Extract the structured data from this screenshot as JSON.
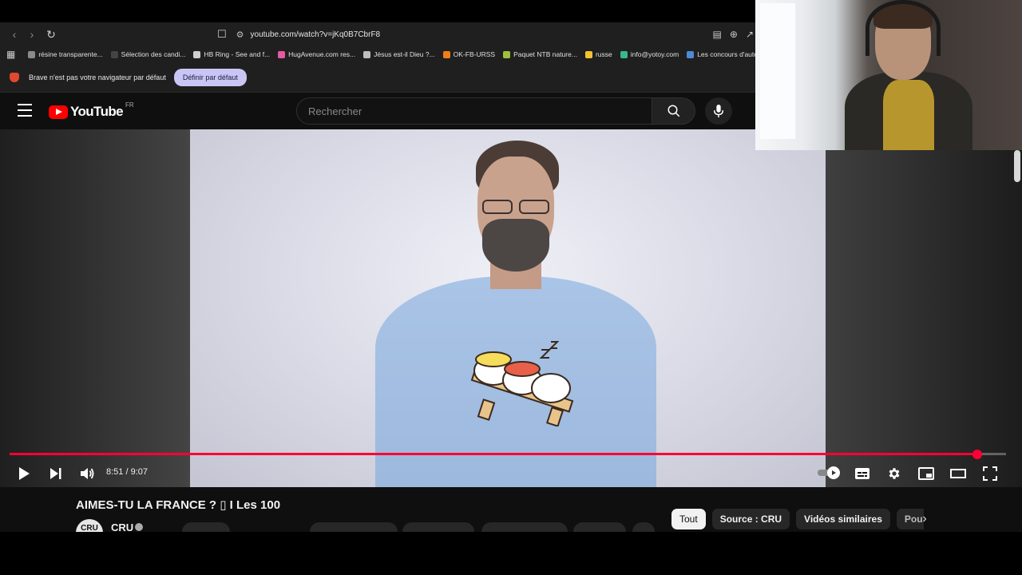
{
  "browser": {
    "url": "youtube.com/watch?v=jKq0B7CbrF8",
    "bookmarks": [
      {
        "label": "résine transparente...",
        "color": "#8a8a8a"
      },
      {
        "label": "Sélection des candi...",
        "color": "#444444"
      },
      {
        "label": "HB Ring - See and f...",
        "color": "#cfcfcf"
      },
      {
        "label": "HugAvenue.com res...",
        "color": "#e55aa0"
      },
      {
        "label": "Jésus est-il Dieu ?...",
        "color": "#bdbdbd"
      },
      {
        "label": "OK-FB-URSS",
        "color": "#f07d1a"
      },
      {
        "label": "Paquet NTB nature...",
        "color": "#9bc23c"
      },
      {
        "label": "russe",
        "color": "#f2c230"
      },
      {
        "label": "info@yotoy.com",
        "color": "#3bb58a"
      },
      {
        "label": "Les concours d'aute...",
        "color": "#4d8ad6"
      }
    ],
    "infobar": {
      "message": "Brave n'est pas votre navigateur par défaut",
      "button": "Définir par défaut"
    }
  },
  "youtube": {
    "logo_text": "YouTube",
    "country_code": "FR",
    "search_placeholder": "Rechercher"
  },
  "player": {
    "current_time": "8:51",
    "duration": "9:07",
    "time_display": "8:51 / 9:07",
    "progress": 0.971
  },
  "video": {
    "title": "AIMES-TU LA FRANCE ? ▯ I Les 100",
    "channel": "CRU",
    "avatar_text": "CRU"
  },
  "chips": [
    {
      "label": "Tout",
      "active": true
    },
    {
      "label": "Source : CRU",
      "active": false
    },
    {
      "label": "Vidéos similaires",
      "active": false
    },
    {
      "label": "Pou",
      "active": false
    }
  ],
  "colors": {
    "accent": "#ff0033",
    "youtube_red": "#ff0000",
    "background": "#0f0f0f"
  }
}
